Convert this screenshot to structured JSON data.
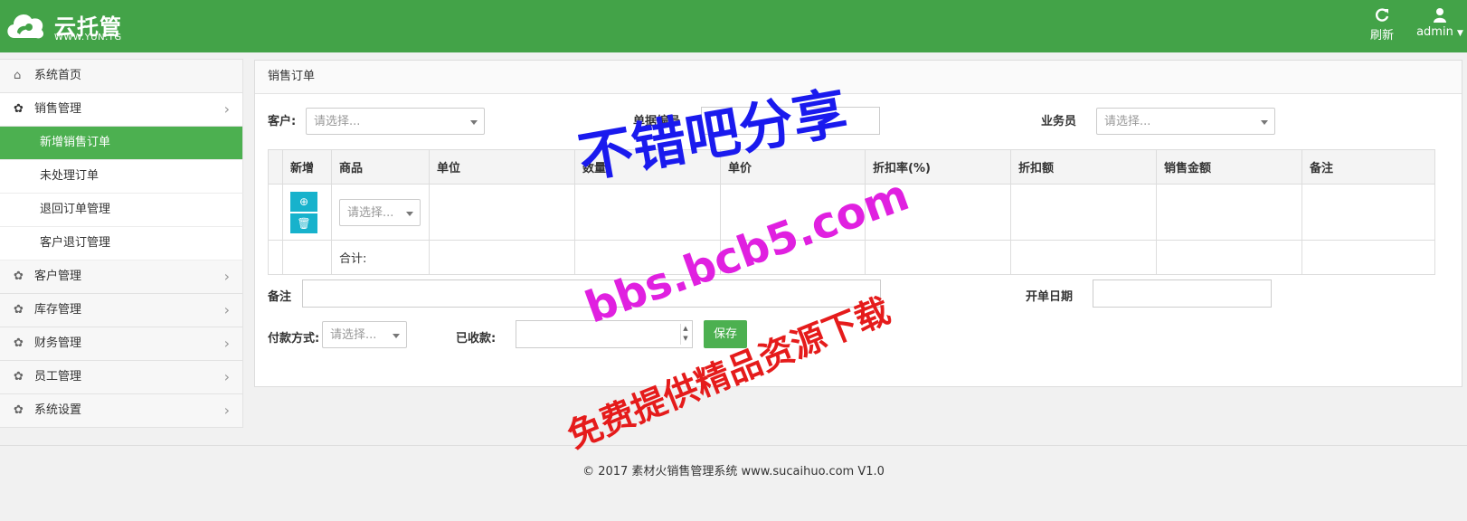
{
  "header": {
    "logo_cn": "云托管",
    "logo_en": "WWW.YUN.TG",
    "refresh_label": "刷新",
    "user_label": "admin"
  },
  "sidebar": {
    "items": [
      {
        "label": "系统首页",
        "icon": "home-icon"
      },
      {
        "label": "销售管理",
        "icon": "gear-icon",
        "expanded": true,
        "children": [
          "新增销售订单",
          "未处理订单",
          "退回订单管理",
          "客户退订管理"
        ]
      },
      {
        "label": "客户管理",
        "icon": "gear-icon"
      },
      {
        "label": "库存管理",
        "icon": "gear-icon"
      },
      {
        "label": "财务管理",
        "icon": "gear-icon"
      },
      {
        "label": "员工管理",
        "icon": "gear-icon"
      },
      {
        "label": "系统设置",
        "icon": "gear-icon"
      }
    ]
  },
  "panel": {
    "title": "销售订单",
    "customer_label": "客户:",
    "customer_placeholder": "请选择...",
    "doc_no_label": "单据编号",
    "salesman_label": "业务员",
    "salesman_placeholder": "请选择...",
    "table": {
      "headers": [
        "新增",
        "商品",
        "单位",
        "数量",
        "单价",
        "折扣率(%)",
        "折扣额",
        "销售金额",
        "备注"
      ],
      "product_placeholder": "请选择...",
      "total_label": "合计:"
    },
    "remark_label": "备注",
    "open_date_label": "开单日期",
    "payment_label": "付款方式:",
    "payment_placeholder": "请选择...",
    "received_label": "已收款:",
    "save_label": "保存"
  },
  "footer": {
    "text": "© 2017 素材火销售管理系统 www.sucaihuo.com V1.0"
  },
  "watermark": {
    "line1": "不错吧分享",
    "line2": "bbs.bcb5.com",
    "line3": "免费提供精品资源下载"
  },
  "colors": {
    "brand_green": "#43a348",
    "active_green": "#4cb050",
    "button_cyan": "#17b2cc"
  }
}
